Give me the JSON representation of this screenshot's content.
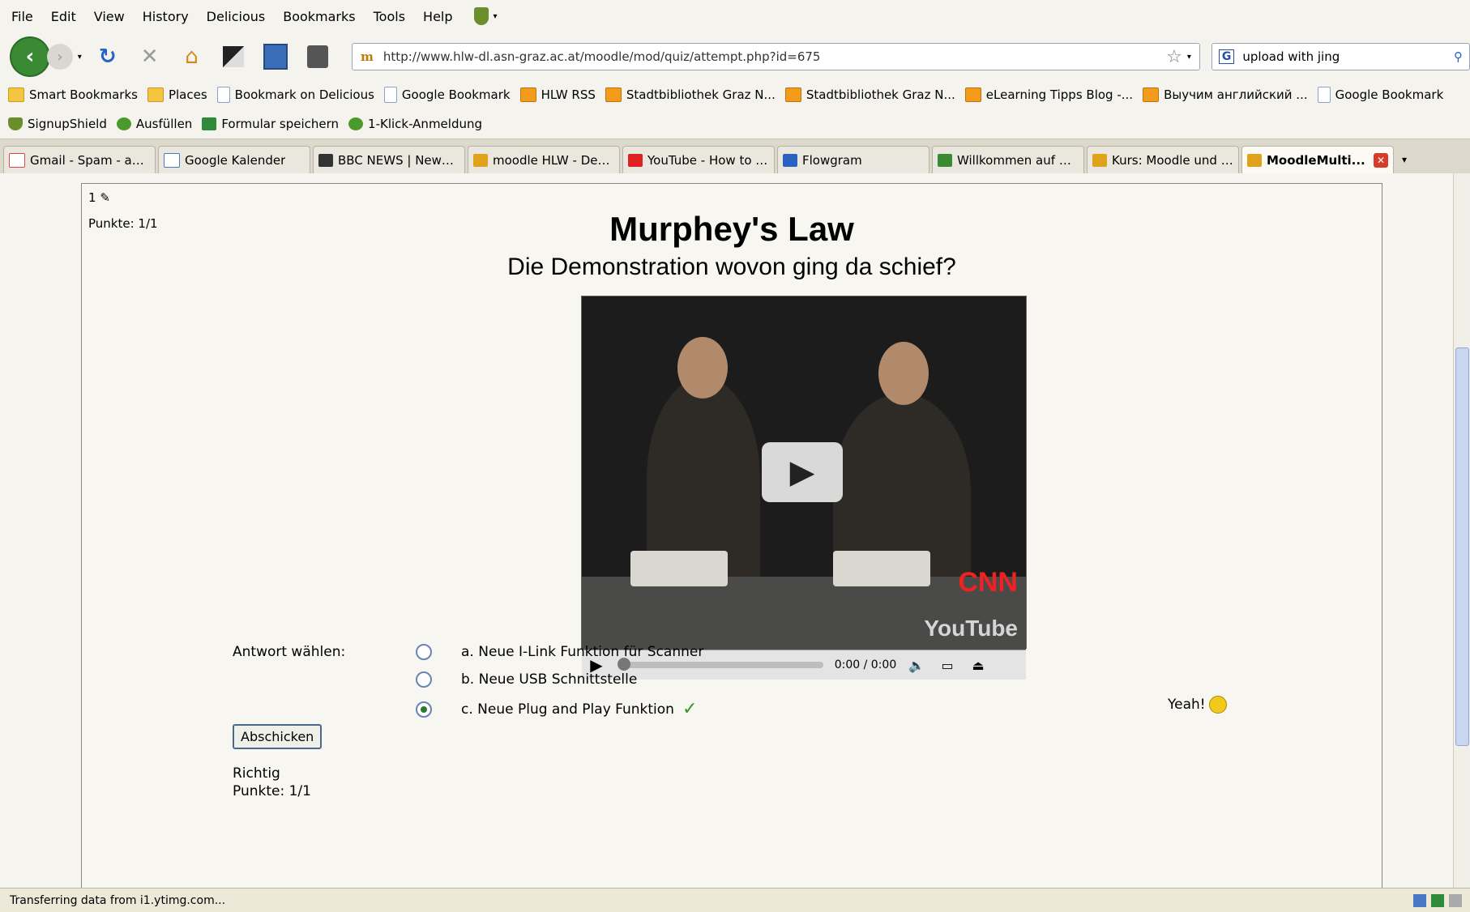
{
  "menu": {
    "items": [
      "File",
      "Edit",
      "View",
      "History",
      "Delicious",
      "Bookmarks",
      "Tools",
      "Help"
    ]
  },
  "nav": {
    "url": "http://www.hlw-dl.asn-graz.ac.at/moodle/mod/quiz/attempt.php?id=675",
    "site_icon": "m",
    "search_query": "upload with jing",
    "search_engine_icon": "G"
  },
  "bookmarks": [
    {
      "label": "Smart Bookmarks",
      "icon": "folder"
    },
    {
      "label": "Places",
      "icon": "folder"
    },
    {
      "label": "Bookmark on Delicious",
      "icon": "page"
    },
    {
      "label": "Google Bookmark",
      "icon": "page"
    },
    {
      "label": "HLW RSS",
      "icon": "rss"
    },
    {
      "label": "Stadtbibliothek Graz N...",
      "icon": "rss"
    },
    {
      "label": "Stadtbibliothek Graz N...",
      "icon": "rss"
    },
    {
      "label": "eLearning Tipps Blog -...",
      "icon": "rss"
    },
    {
      "label": "Выучим английский ...",
      "icon": "rss"
    },
    {
      "label": "Google Bookmark",
      "icon": "page"
    }
  ],
  "addons": [
    "SignupShield",
    "Ausfüllen",
    "Formular speichern",
    "1-Klick-Anmeldung"
  ],
  "tabs": [
    {
      "label": "Gmail - Spam - andr..."
    },
    {
      "label": "Google Kalender"
    },
    {
      "label": "BBC NEWS | News F..."
    },
    {
      "label": "moodle HLW - Deuts..."
    },
    {
      "label": "YouTube - How to U..."
    },
    {
      "label": "Flowgram"
    },
    {
      "label": "Willkommen auf der ..."
    },
    {
      "label": "Kurs: Moodle und M..."
    },
    {
      "label": "MoodleMulti..."
    }
  ],
  "quiz": {
    "number": "1",
    "grade": "Punkte: 1/1",
    "title": "Murphey's Law",
    "subtitle": "Die Demonstration wovon ging da schief?",
    "video": {
      "time": "0:00 / 0:00",
      "logo_cnn": "CNN",
      "logo_youtube": "YouTube"
    },
    "answer_label": "Antwort wählen:",
    "options": [
      {
        "label": "a. Neue I-Link Funktion für Scanner",
        "selected": false
      },
      {
        "label": "b. Neue USB Schnittstelle",
        "selected": false
      },
      {
        "label": "c. Neue Plug and Play Funktion",
        "selected": true
      }
    ],
    "feedback": "Yeah!",
    "submit_label": "Abschicken",
    "result": "Richtig",
    "result_grade": "Punkte: 1/1"
  },
  "status": {
    "text": "Transferring data from i1.ytimg.com..."
  }
}
